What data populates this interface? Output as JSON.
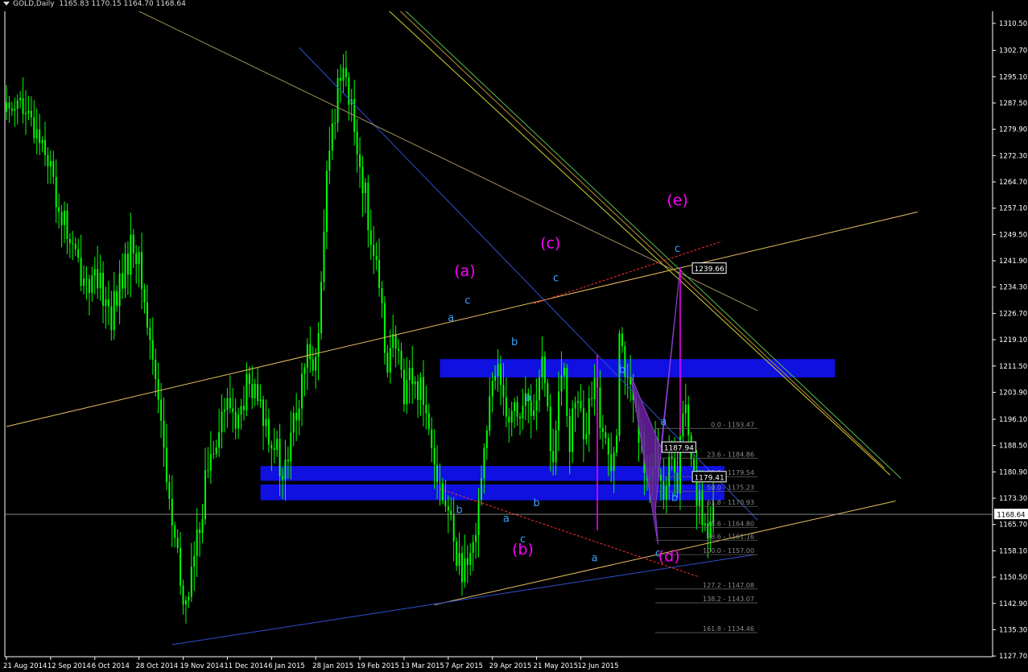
{
  "header": {
    "symbol": "GOLD,Daily",
    "ohlc": "1165.83 1170.15 1164.70 1168.64"
  },
  "colors": {
    "background": "#000000",
    "candle": "#00ff00",
    "axis": "#ffffff",
    "wave_label": "#ff00ff",
    "sub_label": "#3aa0ff",
    "zone": "#1010e0",
    "trend_yellow": "#e8c060",
    "trend_blue": "#3050d0",
    "fib_line": "#606060",
    "fib_text": "#8a8a8a"
  },
  "chart_data": {
    "type": "candlestick",
    "y_axis": {
      "min": 1127.5,
      "max": 1314.0,
      "ticks": [
        "1310.50",
        "1302.70",
        "1295.10",
        "1287.50",
        "1279.90",
        "1272.30",
        "1264.70",
        "1257.10",
        "1249.50",
        "1241.90",
        "1234.30",
        "1226.70",
        "1219.10",
        "1211.50",
        "1203.90",
        "1196.10",
        "1188.50",
        "1180.90",
        "1173.30",
        "1165.70",
        "1158.10",
        "1150.50",
        "1142.90",
        "1135.30",
        "1127.70"
      ]
    },
    "x_axis": {
      "ticks": [
        "21 Aug 2014",
        "12 Sep 2014",
        "6 Oct 2014",
        "28 Oct 2014",
        "19 Nov 2014",
        "11 Dec 2014",
        "6 Jan 2015",
        "28 Jan 2015",
        "19 Feb 2015",
        "13 Mar 2015",
        "7 Apr 2015",
        "29 Apr 2015",
        "21 May 2015",
        "12 Jun 2015"
      ],
      "bar_index": [
        0,
        16,
        32,
        48,
        64,
        80,
        96,
        112,
        128,
        144,
        160,
        176,
        192,
        208
      ]
    },
    "last_price": "1168.64",
    "price_path": [
      [
        0,
        1285
      ],
      [
        4,
        1290
      ],
      [
        7,
        1282
      ],
      [
        11,
        1280
      ],
      [
        14,
        1276
      ],
      [
        18,
        1260
      ],
      [
        22,
        1250
      ],
      [
        26,
        1240
      ],
      [
        30,
        1236
      ],
      [
        35,
        1233
      ],
      [
        38,
        1226
      ],
      [
        40,
        1232
      ],
      [
        44,
        1242
      ],
      [
        46,
        1248
      ],
      [
        48,
        1240
      ],
      [
        50,
        1230
      ],
      [
        52,
        1218
      ],
      [
        55,
        1205
      ],
      [
        58,
        1178
      ],
      [
        61,
        1160
      ],
      [
        64,
        1142
      ],
      [
        66,
        1148
      ],
      [
        69,
        1160
      ],
      [
        72,
        1178
      ],
      [
        75,
        1190
      ],
      [
        78,
        1198
      ],
      [
        81,
        1200
      ],
      [
        84,
        1195
      ],
      [
        87,
        1205
      ],
      [
        90,
        1202
      ],
      [
        94,
        1195
      ],
      [
        97,
        1190
      ],
      [
        100,
        1178
      ],
      [
        102,
        1185
      ],
      [
        104,
        1195
      ],
      [
        106,
        1200
      ],
      [
        108,
        1210
      ],
      [
        110,
        1218
      ],
      [
        112,
        1212
      ],
      [
        114,
        1232
      ],
      [
        116,
        1265
      ],
      [
        118,
        1280
      ],
      [
        120,
        1292
      ],
      [
        122,
        1302
      ],
      [
        124,
        1288
      ],
      [
        126,
        1280
      ],
      [
        128,
        1270
      ],
      [
        130,
        1260
      ],
      [
        132,
        1250
      ],
      [
        134,
        1238
      ],
      [
        136,
        1225
      ],
      [
        138,
        1214
      ],
      [
        140,
        1218
      ],
      [
        142,
        1212
      ],
      [
        144,
        1205
      ],
      [
        146,
        1210
      ],
      [
        148,
        1204
      ],
      [
        150,
        1208
      ],
      [
        152,
        1198
      ],
      [
        154,
        1192
      ],
      [
        156,
        1182
      ],
      [
        158,
        1172
      ],
      [
        160,
        1170
      ],
      [
        161,
        1165
      ],
      [
        163,
        1158
      ],
      [
        165,
        1152
      ],
      [
        167,
        1150
      ],
      [
        169,
        1160
      ],
      [
        171,
        1175
      ],
      [
        173,
        1188
      ],
      [
        175,
        1200
      ],
      [
        177,
        1207
      ],
      [
        178,
        1213
      ],
      [
        180,
        1204
      ],
      [
        182,
        1198
      ],
      [
        184,
        1200
      ],
      [
        186,
        1197
      ],
      [
        188,
        1202
      ],
      [
        190,
        1197
      ],
      [
        192,
        1204
      ],
      [
        194,
        1210
      ],
      [
        196,
        1197
      ],
      [
        198,
        1184
      ],
      [
        200,
        1200
      ],
      [
        202,
        1210
      ],
      [
        204,
        1190
      ],
      [
        206,
        1200
      ],
      [
        207,
        1205
      ],
      [
        209,
        1188
      ],
      [
        211,
        1198
      ],
      [
        213,
        1205
      ],
      [
        215,
        1198
      ],
      [
        217,
        1188
      ],
      [
        219,
        1185
      ],
      [
        221,
        1196
      ],
      [
        222,
        1225
      ],
      [
        223,
        1218
      ],
      [
        225,
        1205
      ],
      [
        227,
        1200
      ],
      [
        229,
        1190
      ],
      [
        231,
        1185
      ],
      [
        233,
        1180
      ],
      [
        235,
        1186
      ],
      [
        237,
        1175
      ],
      [
        239,
        1180
      ],
      [
        241,
        1182
      ],
      [
        243,
        1175
      ],
      [
        245,
        1200
      ],
      [
        246,
        1198
      ],
      [
        247,
        1190
      ],
      [
        249,
        1180
      ],
      [
        251,
        1172
      ],
      [
        253,
        1165
      ],
      [
        254,
        1160
      ],
      [
        255,
        1162
      ],
      [
        256,
        1168
      ]
    ],
    "wave_labels": [
      {
        "text": "(a)",
        "bar": 166,
        "price": 1237.5
      },
      {
        "text": "(b)",
        "bar": 187,
        "price": 1157.0
      },
      {
        "text": "(c)",
        "bar": 197,
        "price": 1245.5
      },
      {
        "text": "(d)",
        "bar": 240,
        "price": 1155.0
      },
      {
        "text": "(e)",
        "bar": 243,
        "price": 1258.0
      }
    ],
    "sub_labels": [
      {
        "text": "a",
        "bar": 161,
        "price": 1224.5
      },
      {
        "text": "c",
        "bar": 167,
        "price": 1229.5
      },
      {
        "text": "b",
        "bar": 164,
        "price": 1169.0
      },
      {
        "text": "b",
        "bar": 184,
        "price": 1217.5
      },
      {
        "text": "a",
        "bar": 189,
        "price": 1201.5
      },
      {
        "text": "b",
        "bar": 192,
        "price": 1171.0
      },
      {
        "text": "a",
        "bar": 181,
        "price": 1166.5
      },
      {
        "text": "c",
        "bar": 187,
        "price": 1160.5
      },
      {
        "text": "c",
        "bar": 199,
        "price": 1236.0
      },
      {
        "text": "b",
        "bar": 223,
        "price": 1209.5
      },
      {
        "text": "a",
        "bar": 238,
        "price": 1194.5
      },
      {
        "text": "b",
        "bar": 242,
        "price": 1172.5
      },
      {
        "text": "a",
        "bar": 213,
        "price": 1155.0
      },
      {
        "text": "c",
        "bar": 236,
        "price": 1156.5
      },
      {
        "text": "c",
        "bar": 243,
        "price": 1244.5
      }
    ],
    "zones": [
      {
        "bar_from": 157,
        "bar_to": 300,
        "price_top": 1213.5,
        "price_bottom": 1208.2
      },
      {
        "bar_from": 92,
        "bar_to": 260,
        "price_top": 1182.6,
        "price_bottom": 1178.3
      },
      {
        "bar_from": 92,
        "bar_to": 260,
        "price_top": 1177.3,
        "price_bottom": 1172.7
      }
    ],
    "trendlines": [
      {
        "name": "upper-channel",
        "color": "#e8c060",
        "p1": [
          0,
          1194.0
        ],
        "p2": [
          330,
          1256.0
        ]
      },
      {
        "name": "lower-channel",
        "color": "#e8c060",
        "p1": [
          155,
          1142.5
        ],
        "p2": [
          322,
          1172.5
        ]
      },
      {
        "name": "blue-support",
        "color": "#3050d0",
        "p1": [
          60,
          1131.0
        ],
        "p2": [
          271,
          1157.0
        ]
      },
      {
        "name": "blue-resistance",
        "color": "#3050d0",
        "p1": [
          106,
          1303.5
        ],
        "p2": [
          272,
          1167.0
        ]
      },
      {
        "name": "long-resistance",
        "color": "#a09060",
        "p1": [
          48,
          1314.0
        ],
        "p2": [
          272,
          1227.5
        ]
      },
      {
        "name": "yellow-diag-1",
        "color": "#d0d030",
        "p1": [
          136,
          1316.0
        ],
        "p2": [
          320,
          1180.0
        ]
      },
      {
        "name": "yellow-diag-2",
        "color": "#c09030",
        "p1": [
          140,
          1316.0
        ],
        "p2": [
          318,
          1182.0
        ]
      },
      {
        "name": "green-diag",
        "color": "#50c050",
        "p1": [
          142,
          1316.0
        ],
        "p2": [
          324,
          1179.0
        ]
      }
    ],
    "dashed_lines": [
      {
        "name": "red-upper",
        "color": "#ff3030",
        "p1": [
          191,
          1229.5
        ],
        "p2": [
          259,
          1247.5
        ]
      },
      {
        "name": "red-lower",
        "color": "#ff3030",
        "p1": [
          157,
          1176.0
        ],
        "p2": [
          251,
          1150.5
        ]
      }
    ],
    "magenta_verticals": [
      {
        "bar": 214,
        "price_top": 1214.8,
        "price_bottom": 1164.0
      },
      {
        "bar": 244,
        "price_top": 1240.0,
        "price_bottom": 1192.0
      }
    ],
    "purple_zigzag": [
      [
        226,
        1209.0
      ],
      [
        237,
        1188.0
      ],
      [
        244,
        1240.0
      ],
      [
        235,
        1170.0
      ],
      [
        236,
        1160.0
      ]
    ],
    "boxed_prices": [
      {
        "text": "1239.66",
        "bar": 249,
        "price": 1239.66
      },
      {
        "text": "1187.94",
        "bar": 238,
        "price": 1187.94
      },
      {
        "text": "1179.41",
        "bar": 249,
        "price": 1179.41
      }
    ],
    "fibonacci": {
      "bar_from": 235,
      "bar_to": 272,
      "levels": [
        {
          "label": "0.0 - 1193.47",
          "price": 1193.47
        },
        {
          "label": "23.6 - 1184.86",
          "price": 1184.86
        },
        {
          "label": "38.2 - 1179.54",
          "price": 1179.54
        },
        {
          "label": "50.0 - 1175.23",
          "price": 1175.23
        },
        {
          "label": "61.8 - 1170.93",
          "price": 1170.93
        },
        {
          "label": "78.6 - 1164.80",
          "price": 1164.8
        },
        {
          "label": "88.6 - 1161.16",
          "price": 1161.16
        },
        {
          "label": "100.0 - 1157.00",
          "price": 1157.0
        },
        {
          "label": "127.2 - 1147.08",
          "price": 1147.08
        },
        {
          "label": "138.2 - 1143.07",
          "price": 1143.07
        },
        {
          "label": "161.8 - 1134.46",
          "price": 1134.46
        }
      ]
    }
  }
}
